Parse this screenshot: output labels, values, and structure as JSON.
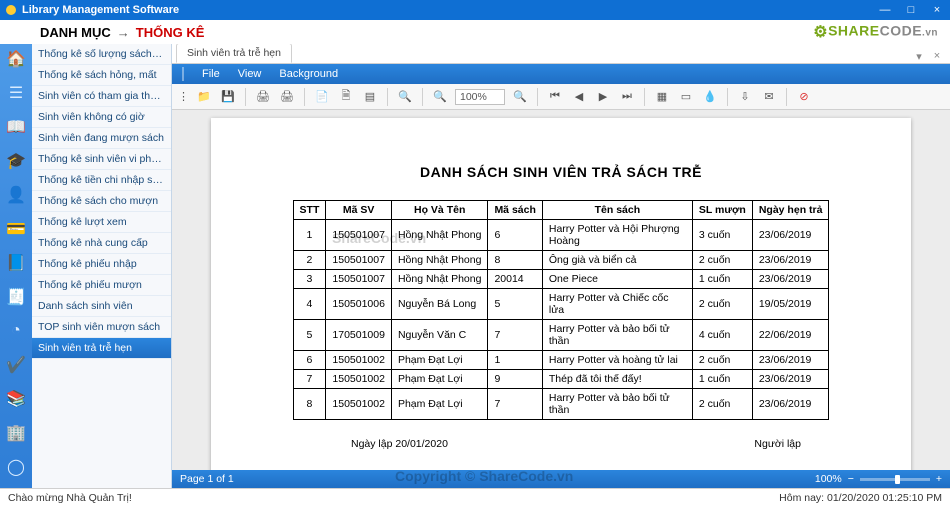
{
  "window": {
    "title": "Library Management Software",
    "min": "—",
    "max": "□",
    "close": "×"
  },
  "breadcrumb": {
    "first": "DANH MỤC",
    "arrow": "→",
    "second": "THỐNG KÊ"
  },
  "logo": {
    "gear": "⚙",
    "share": "SHARE",
    "code": "CODE",
    "vn": ".vn"
  },
  "sidebar": {
    "items": [
      "Thống kê số lượng sách nhập",
      "Thống kê sách hỏng, mất",
      "Sinh viên có tham gia thư viện",
      "Sinh viên không có giờ",
      "Sinh viên đang mượn sách",
      "Thống kê sinh viên vi phạm",
      "Thống kê tiền chi nhập sách",
      "Thống kê sách cho mượn",
      "Thống kê lượt xem",
      "Thống kê nhà cung cấp",
      "Thống kê phiếu nhập",
      "Thống kê phiếu mượn",
      "Danh sách sinh viên",
      "TOP sinh viên mượn sách",
      "Sinh viên trả trễ hẹn"
    ],
    "activeIndex": 14
  },
  "tab": {
    "label": "Sinh viên trả trễ hẹn"
  },
  "menubar": {
    "file": "File",
    "view": "View",
    "background": "Background"
  },
  "toolbar": {
    "zoom": "100%"
  },
  "report": {
    "title": "DANH SÁCH SINH VIÊN TRẢ SÁCH TRỄ",
    "headers": [
      "STT",
      "Mã SV",
      "Họ Và Tên",
      "Mã sách",
      "Tên sách",
      "SL mượn",
      "Ngày hẹn trả"
    ],
    "rows": [
      [
        "1",
        "150501007",
        "Hồng Nhật Phong",
        "6",
        "Harry Potter và Hội Phượng Hoàng",
        "3 cuốn",
        "23/06/2019"
      ],
      [
        "2",
        "150501007",
        "Hồng Nhật Phong",
        "8",
        "Ông già và biển cả",
        "2 cuốn",
        "23/06/2019"
      ],
      [
        "3",
        "150501007",
        "Hồng Nhật Phong",
        "20014",
        "One Piece",
        "1 cuốn",
        "23/06/2019"
      ],
      [
        "4",
        "150501006",
        "Nguyễn Bá Long",
        "5",
        "Harry Potter và Chiếc cốc lửa",
        "2 cuốn",
        "19/05/2019"
      ],
      [
        "5",
        "170501009",
        "Nguyễn Văn C",
        "7",
        "Harry Potter và bảo bối tử thần",
        "4 cuốn",
        "22/06/2019"
      ],
      [
        "6",
        "150501002",
        "Phạm Đạt Lợi",
        "1",
        "Harry Potter và hoàng tử lai",
        "2 cuốn",
        "23/06/2019"
      ],
      [
        "7",
        "150501002",
        "Phạm Đạt Lợi",
        "9",
        "Thép đã tôi thế đấy!",
        "1 cuốn",
        "23/06/2019"
      ],
      [
        "8",
        "150501002",
        "Phạm Đạt Lợi",
        "7",
        "Harry Potter và bảo bối tử thần",
        "2 cuốn",
        "23/06/2019"
      ]
    ],
    "footer_left": "Ngày lập 20/01/2020",
    "footer_right": "Người lập"
  },
  "viewer_status": {
    "page": "Page 1 of 1",
    "zoom": "100%",
    "minus": "−",
    "plus": "+"
  },
  "app_status": {
    "left": "Chào mừng Nhà Quản Trị!",
    "right": "Hôm nay: 01/20/2020 01:25:10 PM"
  },
  "watermark1": "ShareCode.vn",
  "watermark2": "Copyright © ShareCode.vn"
}
